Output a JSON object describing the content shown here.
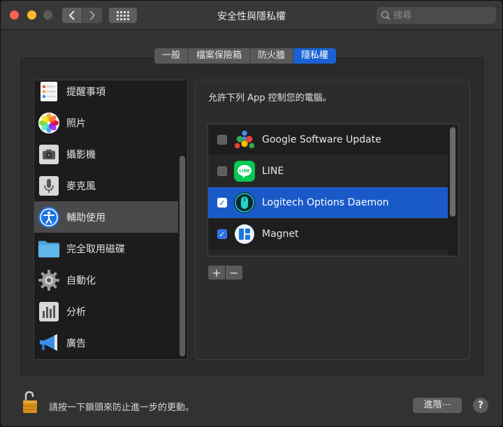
{
  "window": {
    "title": "安全性與隱私權"
  },
  "search": {
    "placeholder": "搜尋"
  },
  "tabs": [
    {
      "label": "一般",
      "active": false
    },
    {
      "label": "檔案保險箱",
      "active": false
    },
    {
      "label": "防火牆",
      "active": false
    },
    {
      "label": "隱私權",
      "active": true
    }
  ],
  "sidebar": {
    "items": [
      {
        "label": "提醒事項",
        "icon": "reminders-icon"
      },
      {
        "label": "照片",
        "icon": "photos-icon"
      },
      {
        "label": "攝影機",
        "icon": "camera-icon"
      },
      {
        "label": "麥克風",
        "icon": "microphone-icon"
      },
      {
        "label": "輔助使用",
        "icon": "accessibility-icon",
        "selected": true
      },
      {
        "label": "完全取用磁碟",
        "icon": "folder-icon"
      },
      {
        "label": "自動化",
        "icon": "gear-icon"
      },
      {
        "label": "分析",
        "icon": "analytics-icon"
      },
      {
        "label": "廣告",
        "icon": "megaphone-icon"
      }
    ]
  },
  "pane": {
    "caption": "允許下列 App 控制您的電腦。",
    "apps": [
      {
        "name": "Google Software Update",
        "checked": false,
        "icon": "google-update-icon"
      },
      {
        "name": "LINE",
        "checked": false,
        "icon": "line-icon"
      },
      {
        "name": "Logitech Options Daemon",
        "checked": true,
        "selected": true,
        "icon": "logitech-mouse-icon"
      },
      {
        "name": "Magnet",
        "checked": true,
        "icon": "magnet-icon"
      }
    ],
    "add_label": "+",
    "remove_label": "−"
  },
  "footer": {
    "lock_text": "請按一下鎖頭來防止進一步的更動。",
    "advanced_label": "進階⋯",
    "help_label": "?"
  },
  "colors": {
    "accent": "#1a62d4",
    "selected_row": "#1a5ac8"
  }
}
